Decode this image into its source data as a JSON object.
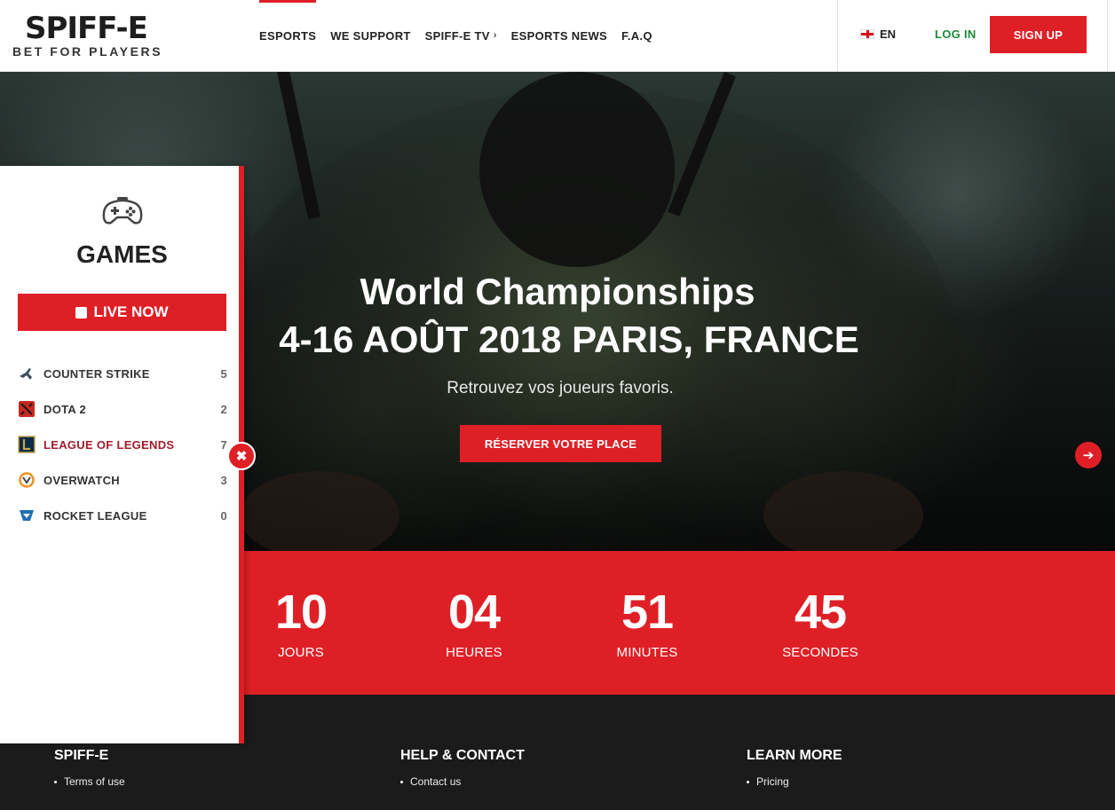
{
  "brand": {
    "logo": "SPIFF-E",
    "tagline": "BET FOR PLAYERS"
  },
  "nav": {
    "items": [
      {
        "label": "ESPORTS"
      },
      {
        "label": "WE SUPPORT"
      },
      {
        "label": "SPIFF-E TV"
      },
      {
        "label": "ESPORTS NEWS"
      },
      {
        "label": "F.A.Q"
      }
    ],
    "chevron": "›",
    "lang": "EN",
    "login": "LOG IN",
    "signup": "SIGN UP"
  },
  "hero": {
    "title_line1": "World Championships",
    "title_line2": "4-16 AOÛT 2018 PARIS, FRANCE",
    "subtitle": "Retrouvez vos joueurs favoris.",
    "cta": "RÉSERVER VOTRE PLACE",
    "next_arrow": "➔"
  },
  "countdown": [
    {
      "value": "10",
      "label": "JOURS"
    },
    {
      "value": "04",
      "label": "HEURES"
    },
    {
      "value": "51",
      "label": "MINUTES"
    },
    {
      "value": "45",
      "label": "SECONDES"
    }
  ],
  "sidebar": {
    "title": "GAMES",
    "live_label": "LIVE NOW",
    "close_glyph": "✖",
    "games": [
      {
        "name": "COUNTER STRIKE",
        "count": "5",
        "icon": "counter-strike-icon"
      },
      {
        "name": "DOTA 2",
        "count": "2",
        "icon": "dota2-icon"
      },
      {
        "name": "LEAGUE OF LEGENDS",
        "count": "7",
        "icon": "league-of-legends-icon",
        "active": true
      },
      {
        "name": "OVERWATCH",
        "count": "3",
        "icon": "overwatch-icon"
      },
      {
        "name": "ROCKET LEAGUE",
        "count": "0",
        "icon": "rocket-league-icon"
      }
    ]
  },
  "footer": {
    "columns": [
      {
        "title": "SPIFF-E",
        "links": [
          "Terms of use"
        ]
      },
      {
        "title": "HELP & CONTACT",
        "links": [
          "Contact us"
        ]
      },
      {
        "title": "LEARN MORE",
        "links": [
          "Pricing"
        ]
      }
    ]
  },
  "colors": {
    "accent": "#df1f26",
    "login": "#1c8a3a",
    "footer_bg": "#1b1b1b",
    "active_game": "#a01c2c"
  }
}
